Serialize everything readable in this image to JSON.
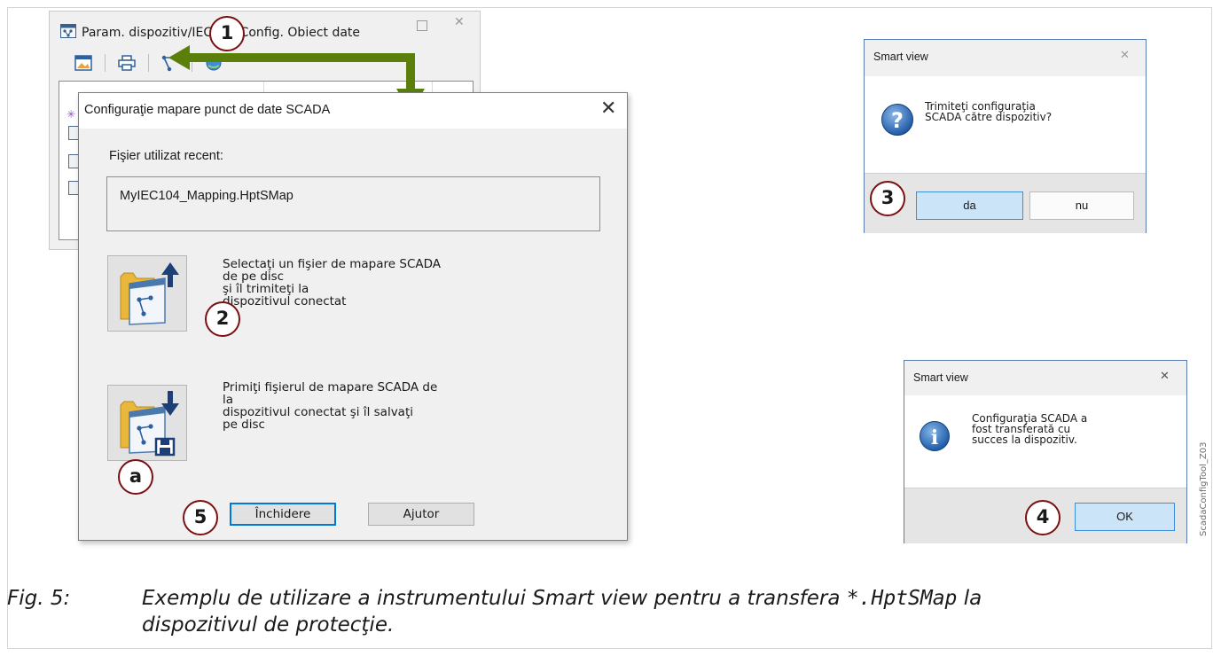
{
  "param_window": {
    "title": "Param. dispozitiv/IEC104/Config. Obiect date",
    "toolbar_icons": [
      "window-image-icon",
      "printer-icon",
      "scada-mapping-icon",
      "globe-icon"
    ]
  },
  "main_dialog": {
    "title": "Configuraţie mapare punct de date SCADA",
    "recent_label": "Fişier utilizat recent:",
    "recent_file": "MyIEC104_Mapping.HptSMap",
    "send_option": {
      "line1": "Selectaţi un fişier de mapare SCADA",
      "line2": "de pe disc",
      "line3": "şi îl trimiteţi la",
      "line4": "dispozitivul conectat"
    },
    "receive_option": {
      "line1": "Primiţi fişierul de mapare SCADA de",
      "line2": "la",
      "line3": "dispozitivul conectat şi îl salvaţi",
      "line4": "pe disc"
    },
    "close_button": "Închidere",
    "help_button": "Ajutor"
  },
  "confirm_dialog": {
    "title": "Smart view",
    "message_line1": "Trimiteţi configuraţia",
    "message_line2": "SCADA către dispozitiv?",
    "yes_button": "da",
    "no_button": "nu"
  },
  "success_dialog": {
    "title": "Smart view",
    "message_line1": "Configuraţia SCADA a",
    "message_line2": "fost transferată cu",
    "message_line3": "succes la dispozitiv.",
    "ok_button": "OK"
  },
  "callouts": {
    "c1": "1",
    "c2": "2",
    "c3": "3",
    "c4": "4",
    "c5": "5",
    "ca": "a"
  },
  "side_label": "ScadaConfigTool_Z03",
  "caption": {
    "number": "Fig. 5:",
    "text_before": "Exemplu de utilizare a instrumentului Smart view pentru a transfera ",
    "code": "*.HptSMap",
    "text_after": " la",
    "line2": "dispozitivul de protecţie."
  },
  "colors": {
    "arrow": "#5b7f0b",
    "callout_border": "#7a1010",
    "primary_button": "#cce4f7",
    "question_icon": "#2e6db4",
    "info_icon": "#1f66b8"
  }
}
